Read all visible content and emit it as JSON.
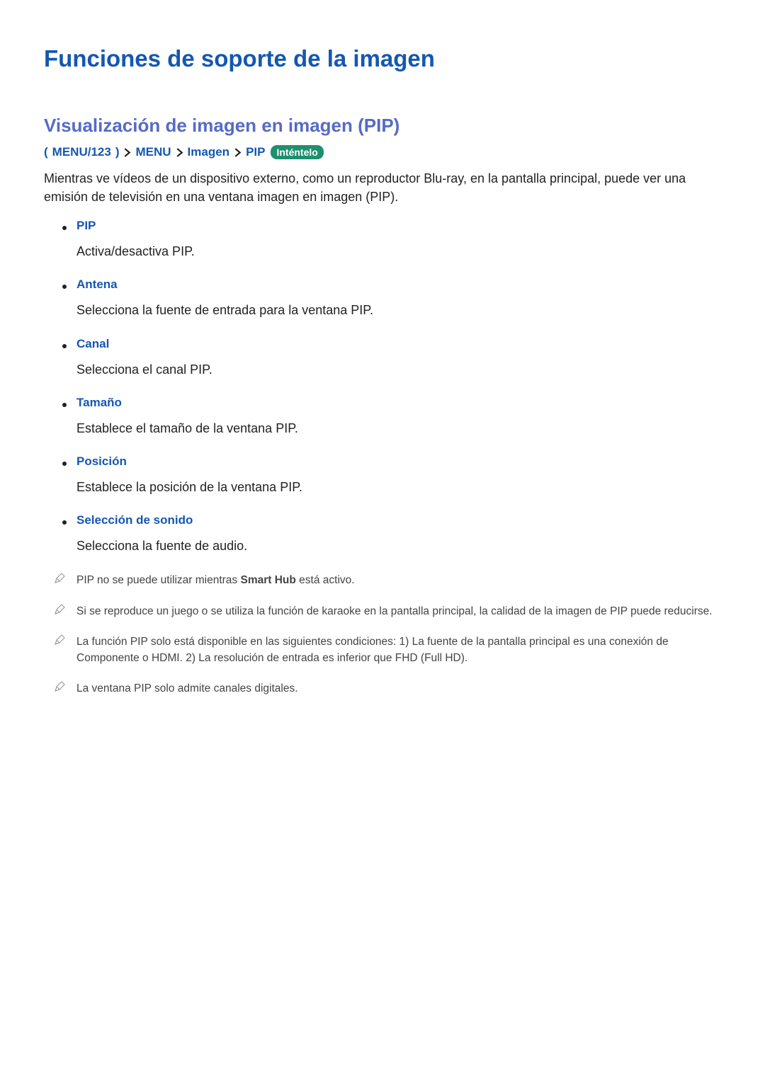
{
  "title": "Funciones de soporte de la imagen",
  "section_title": "Visualización de imagen en imagen (PIP)",
  "breadcrumb": {
    "paren_open": "(",
    "paren_close": ")",
    "step1": "MENU/123",
    "step2": "MENU",
    "step3": "Imagen",
    "step4": "PIP",
    "try_label": "Inténtelo"
  },
  "intro": "Mientras ve vídeos de un dispositivo externo, como un reproductor Blu-ray, en la pantalla principal, puede ver una emisión de televisión en una ventana imagen en imagen (PIP).",
  "features": [
    {
      "title": "PIP",
      "desc": "Activa/desactiva PIP."
    },
    {
      "title": "Antena",
      "desc": "Selecciona la fuente de entrada para la ventana PIP."
    },
    {
      "title": "Canal",
      "desc": "Selecciona el canal PIP."
    },
    {
      "title": "Tamaño",
      "desc": "Establece el tamaño de la ventana PIP."
    },
    {
      "title": "Posición",
      "desc": "Establece la posición de la ventana PIP."
    },
    {
      "title": "Selección de sonido",
      "desc": "Selecciona la fuente de audio."
    }
  ],
  "notes": [
    {
      "pre": "PIP no se puede utilizar mientras ",
      "bold": "Smart Hub",
      "post": " está activo."
    },
    {
      "pre": "Si se reproduce un juego o se utiliza la función de karaoke en la pantalla principal, la calidad de la imagen de PIP puede reducirse.",
      "bold": "",
      "post": ""
    },
    {
      "pre": "La función PIP solo está disponible en las siguientes condiciones: 1) La fuente de la pantalla principal es una conexión de Componente o HDMI. 2) La resolución de entrada es inferior que FHD (Full HD).",
      "bold": "",
      "post": ""
    },
    {
      "pre": "La ventana PIP solo admite canales digitales.",
      "bold": "",
      "post": ""
    }
  ]
}
